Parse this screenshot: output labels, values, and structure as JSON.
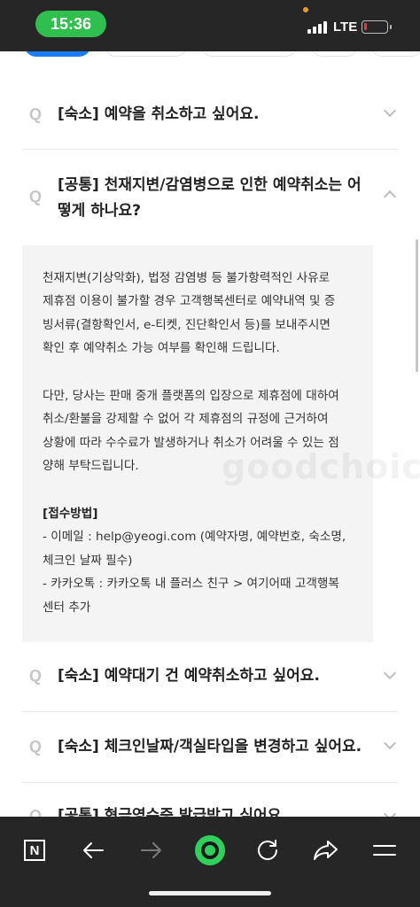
{
  "status_bar": {
    "time": "15:36",
    "network": "LTE"
  },
  "faq": {
    "q_mark": "Q",
    "items": [
      {
        "question": "[숙소] 예약을 취소하고 싶어요."
      },
      {
        "question_line1": "[공통] 천재지변/감염병으로 인한 예약취소는 어",
        "question_line2": "떻게 하나요?"
      },
      {
        "question": "[숙소] 예약대기 건 예약취소하고 싶어요."
      },
      {
        "question": "[숙소] 체크인날짜/객실타입을 변경하고 싶어요."
      },
      {
        "question": "[공통] 현금영수증 발급받고 싶어요."
      }
    ],
    "answer": {
      "para1": [
        "천재지변(기상악화), 법정 감염병 등 불가항력적인 사유로",
        "제휴점 이용이 불가할 경우 고객행복센터로 예약내역 및 증",
        "빙서류(결항확인서, e-티켓, 진단확인서 등)를 보내주시면",
        "확인 후 예약취소 가능 여부를 확인해 드립니다."
      ],
      "para2": [
        "다만, 당사는 판매 중개 플랫폼의 입장으로 제휴점에 대하여",
        "취소/환불을 강제할 수 없어 각 제휴점의 규정에 근거하여",
        "상황에 따라 수수료가 발생하거나 취소가 어려울 수 있는 점",
        "양해 부탁드립니다."
      ],
      "method_title": "[접수방법]",
      "method": [
        "- 이메일 : help@yeogi.com (예약자명, 예약번호, 숙소명,",
        "체크인 날짜 필수)",
        "- 카카오톡 : 카카오톡 내 플러스 친구 > 여기어때 고객행복",
        "센터 추가"
      ]
    }
  },
  "watermark": "goodchoice",
  "toolbar": {
    "naver_label": "N"
  },
  "colors": {
    "accent": "#1c7cf5",
    "toolbar_bg": "#262626",
    "record_green": "#2fd05c"
  }
}
